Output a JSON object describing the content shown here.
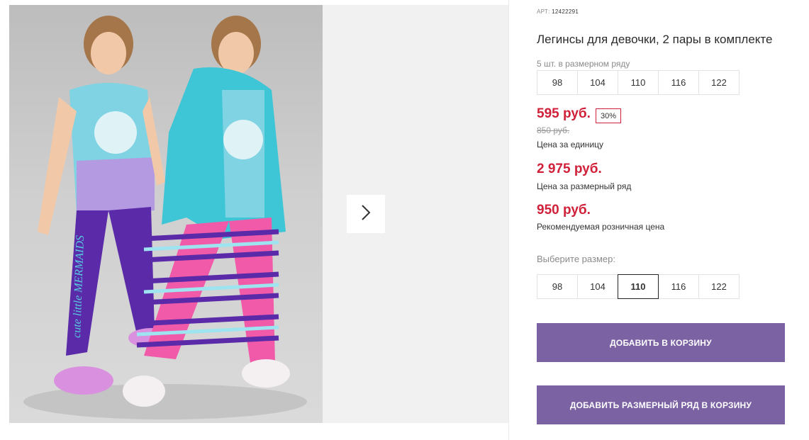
{
  "product": {
    "art_label": "АРТ:",
    "art_value": "12422291",
    "title": "Легинсы для девочки, 2 пары в комплекте",
    "pack_note": "5 шт. в размерном ряду",
    "pack_sizes": [
      "98",
      "104",
      "110",
      "116",
      "122"
    ],
    "price": "595 руб.",
    "discount": "30%",
    "old_price": "850 руб.",
    "price_label": "Цена за единицу",
    "row_price": "2 975 руб.",
    "row_price_label": "Цена за размерный ряд",
    "retail_price": "950 руб.",
    "retail_price_label": "Рекомендуемая розничная цена",
    "choose_label": "Выберите размер:",
    "sizes": [
      "98",
      "104",
      "110",
      "116",
      "122"
    ],
    "selected_size": "110",
    "add_to_cart": "ДОБАВИТЬ В КОРЗИНУ",
    "add_row_to_cart": "ДОБАВИТЬ РАЗМЕРНЫЙ РЯД В КОРЗИНУ"
  },
  "photo": {
    "legging_text": "cute little MERMAIDS"
  },
  "colors": {
    "accent": "#7b62a3",
    "price_red": "#d0203a",
    "turquoise": "#3ec6d6",
    "purple": "#5a2aa8"
  },
  "icons": {
    "next": "chevron-right-icon"
  }
}
